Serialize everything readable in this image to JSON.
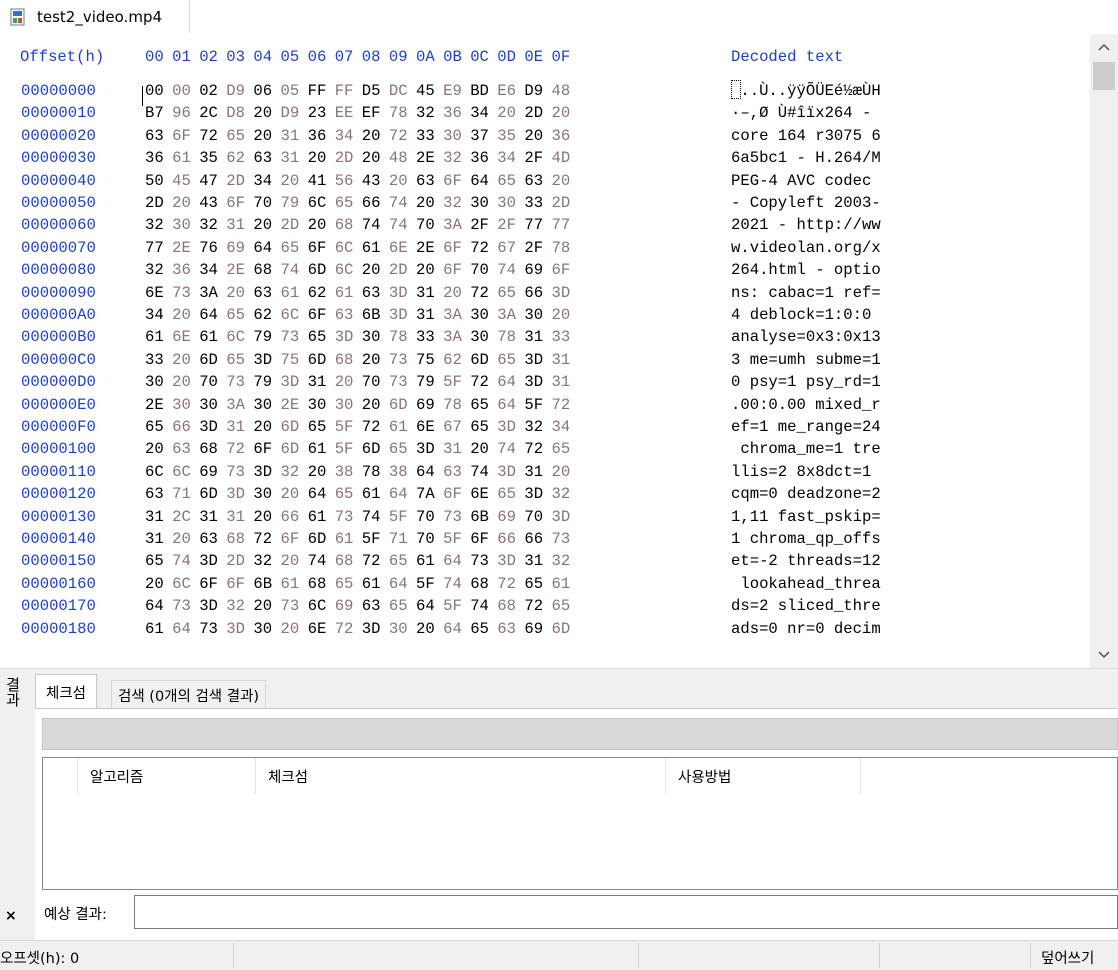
{
  "tab": {
    "filename": "test2_video.mp4",
    "icon": "hex-file-icon"
  },
  "hex": {
    "header_offset": "Offset(h)",
    "header_columns": [
      "00",
      "01",
      "02",
      "03",
      "04",
      "05",
      "06",
      "07",
      "08",
      "09",
      "0A",
      "0B",
      "0C",
      "0D",
      "0E",
      "0F"
    ],
    "header_decoded": "Decoded text",
    "rows": [
      {
        "offset": "00000000",
        "bytes": [
          "00",
          "00",
          "02",
          "D9",
          "06",
          "05",
          "FF",
          "FF",
          "D5",
          "DC",
          "45",
          "E9",
          "BD",
          "E6",
          "D9",
          "48"
        ],
        "decoded": " ..Ù..ÿÿÕÜEé½æÙH"
      },
      {
        "offset": "00000010",
        "bytes": [
          "B7",
          "96",
          "2C",
          "D8",
          "20",
          "D9",
          "23",
          "EE",
          "EF",
          "78",
          "32",
          "36",
          "34",
          "20",
          "2D",
          "20"
        ],
        "decoded": "·–,Ø Ù#îïx264 - "
      },
      {
        "offset": "00000020",
        "bytes": [
          "63",
          "6F",
          "72",
          "65",
          "20",
          "31",
          "36",
          "34",
          "20",
          "72",
          "33",
          "30",
          "37",
          "35",
          "20",
          "36"
        ],
        "decoded": "core 164 r3075 6"
      },
      {
        "offset": "00000030",
        "bytes": [
          "36",
          "61",
          "35",
          "62",
          "63",
          "31",
          "20",
          "2D",
          "20",
          "48",
          "2E",
          "32",
          "36",
          "34",
          "2F",
          "4D"
        ],
        "decoded": "6a5bc1 - H.264/M"
      },
      {
        "offset": "00000040",
        "bytes": [
          "50",
          "45",
          "47",
          "2D",
          "34",
          "20",
          "41",
          "56",
          "43",
          "20",
          "63",
          "6F",
          "64",
          "65",
          "63",
          "20"
        ],
        "decoded": "PEG-4 AVC codec "
      },
      {
        "offset": "00000050",
        "bytes": [
          "2D",
          "20",
          "43",
          "6F",
          "70",
          "79",
          "6C",
          "65",
          "66",
          "74",
          "20",
          "32",
          "30",
          "30",
          "33",
          "2D"
        ],
        "decoded": "- Copyleft 2003-"
      },
      {
        "offset": "00000060",
        "bytes": [
          "32",
          "30",
          "32",
          "31",
          "20",
          "2D",
          "20",
          "68",
          "74",
          "74",
          "70",
          "3A",
          "2F",
          "2F",
          "77",
          "77"
        ],
        "decoded": "2021 - http://ww"
      },
      {
        "offset": "00000070",
        "bytes": [
          "77",
          "2E",
          "76",
          "69",
          "64",
          "65",
          "6F",
          "6C",
          "61",
          "6E",
          "2E",
          "6F",
          "72",
          "67",
          "2F",
          "78"
        ],
        "decoded": "w.videolan.org/x"
      },
      {
        "offset": "00000080",
        "bytes": [
          "32",
          "36",
          "34",
          "2E",
          "68",
          "74",
          "6D",
          "6C",
          "20",
          "2D",
          "20",
          "6F",
          "70",
          "74",
          "69",
          "6F"
        ],
        "decoded": "264.html - optio"
      },
      {
        "offset": "00000090",
        "bytes": [
          "6E",
          "73",
          "3A",
          "20",
          "63",
          "61",
          "62",
          "61",
          "63",
          "3D",
          "31",
          "20",
          "72",
          "65",
          "66",
          "3D"
        ],
        "decoded": "ns: cabac=1 ref="
      },
      {
        "offset": "000000A0",
        "bytes": [
          "34",
          "20",
          "64",
          "65",
          "62",
          "6C",
          "6F",
          "63",
          "6B",
          "3D",
          "31",
          "3A",
          "30",
          "3A",
          "30",
          "20"
        ],
        "decoded": "4 deblock=1:0:0 "
      },
      {
        "offset": "000000B0",
        "bytes": [
          "61",
          "6E",
          "61",
          "6C",
          "79",
          "73",
          "65",
          "3D",
          "30",
          "78",
          "33",
          "3A",
          "30",
          "78",
          "31",
          "33"
        ],
        "decoded": "analyse=0x3:0x13"
      },
      {
        "offset": "000000C0",
        "bytes": [
          "33",
          "20",
          "6D",
          "65",
          "3D",
          "75",
          "6D",
          "68",
          "20",
          "73",
          "75",
          "62",
          "6D",
          "65",
          "3D",
          "31"
        ],
        "decoded": "3 me=umh subme=1"
      },
      {
        "offset": "000000D0",
        "bytes": [
          "30",
          "20",
          "70",
          "73",
          "79",
          "3D",
          "31",
          "20",
          "70",
          "73",
          "79",
          "5F",
          "72",
          "64",
          "3D",
          "31"
        ],
        "decoded": "0 psy=1 psy_rd=1"
      },
      {
        "offset": "000000E0",
        "bytes": [
          "2E",
          "30",
          "30",
          "3A",
          "30",
          "2E",
          "30",
          "30",
          "20",
          "6D",
          "69",
          "78",
          "65",
          "64",
          "5F",
          "72"
        ],
        "decoded": ".00:0.00 mixed_r"
      },
      {
        "offset": "000000F0",
        "bytes": [
          "65",
          "66",
          "3D",
          "31",
          "20",
          "6D",
          "65",
          "5F",
          "72",
          "61",
          "6E",
          "67",
          "65",
          "3D",
          "32",
          "34"
        ],
        "decoded": "ef=1 me_range=24"
      },
      {
        "offset": "00000100",
        "bytes": [
          "20",
          "63",
          "68",
          "72",
          "6F",
          "6D",
          "61",
          "5F",
          "6D",
          "65",
          "3D",
          "31",
          "20",
          "74",
          "72",
          "65"
        ],
        "decoded": " chroma_me=1 tre"
      },
      {
        "offset": "00000110",
        "bytes": [
          "6C",
          "6C",
          "69",
          "73",
          "3D",
          "32",
          "20",
          "38",
          "78",
          "38",
          "64",
          "63",
          "74",
          "3D",
          "31",
          "20"
        ],
        "decoded": "llis=2 8x8dct=1 "
      },
      {
        "offset": "00000120",
        "bytes": [
          "63",
          "71",
          "6D",
          "3D",
          "30",
          "20",
          "64",
          "65",
          "61",
          "64",
          "7A",
          "6F",
          "6E",
          "65",
          "3D",
          "32"
        ],
        "decoded": "cqm=0 deadzone=2"
      },
      {
        "offset": "00000130",
        "bytes": [
          "31",
          "2C",
          "31",
          "31",
          "20",
          "66",
          "61",
          "73",
          "74",
          "5F",
          "70",
          "73",
          "6B",
          "69",
          "70",
          "3D"
        ],
        "decoded": "1,11 fast_pskip="
      },
      {
        "offset": "00000140",
        "bytes": [
          "31",
          "20",
          "63",
          "68",
          "72",
          "6F",
          "6D",
          "61",
          "5F",
          "71",
          "70",
          "5F",
          "6F",
          "66",
          "66",
          "73"
        ],
        "decoded": "1 chroma_qp_offs"
      },
      {
        "offset": "00000150",
        "bytes": [
          "65",
          "74",
          "3D",
          "2D",
          "32",
          "20",
          "74",
          "68",
          "72",
          "65",
          "61",
          "64",
          "73",
          "3D",
          "31",
          "32"
        ],
        "decoded": "et=-2 threads=12"
      },
      {
        "offset": "00000160",
        "bytes": [
          "20",
          "6C",
          "6F",
          "6F",
          "6B",
          "61",
          "68",
          "65",
          "61",
          "64",
          "5F",
          "74",
          "68",
          "72",
          "65",
          "61"
        ],
        "decoded": " lookahead_threa"
      },
      {
        "offset": "00000170",
        "bytes": [
          "64",
          "73",
          "3D",
          "32",
          "20",
          "73",
          "6C",
          "69",
          "63",
          "65",
          "64",
          "5F",
          "74",
          "68",
          "72",
          "65"
        ],
        "decoded": "ds=2 sliced_thre"
      },
      {
        "offset": "00000180",
        "bytes": [
          "61",
          "64",
          "73",
          "3D",
          "30",
          "20",
          "6E",
          "72",
          "3D",
          "30",
          "20",
          "64",
          "65",
          "63",
          "69",
          "6D"
        ],
        "decoded": "ads=0 nr=0 decim"
      }
    ]
  },
  "results": {
    "side_label": "결과",
    "close_glyph": "×",
    "tabs": [
      {
        "label": "체크섬"
      },
      {
        "label": "검색 (0개의 검색 결과)"
      }
    ],
    "columns": [
      "알고리즘",
      "체크섬",
      "사용방법"
    ],
    "expected_label": "예상 결과:",
    "expected_value": ""
  },
  "status": {
    "offset": "오프셋(h): 0",
    "mode": "덮어쓰기"
  },
  "colors": {
    "offset_blue": "#1f3fbf",
    "dim_byte": "#8a7280",
    "panel_bg": "#f0f0f0"
  }
}
